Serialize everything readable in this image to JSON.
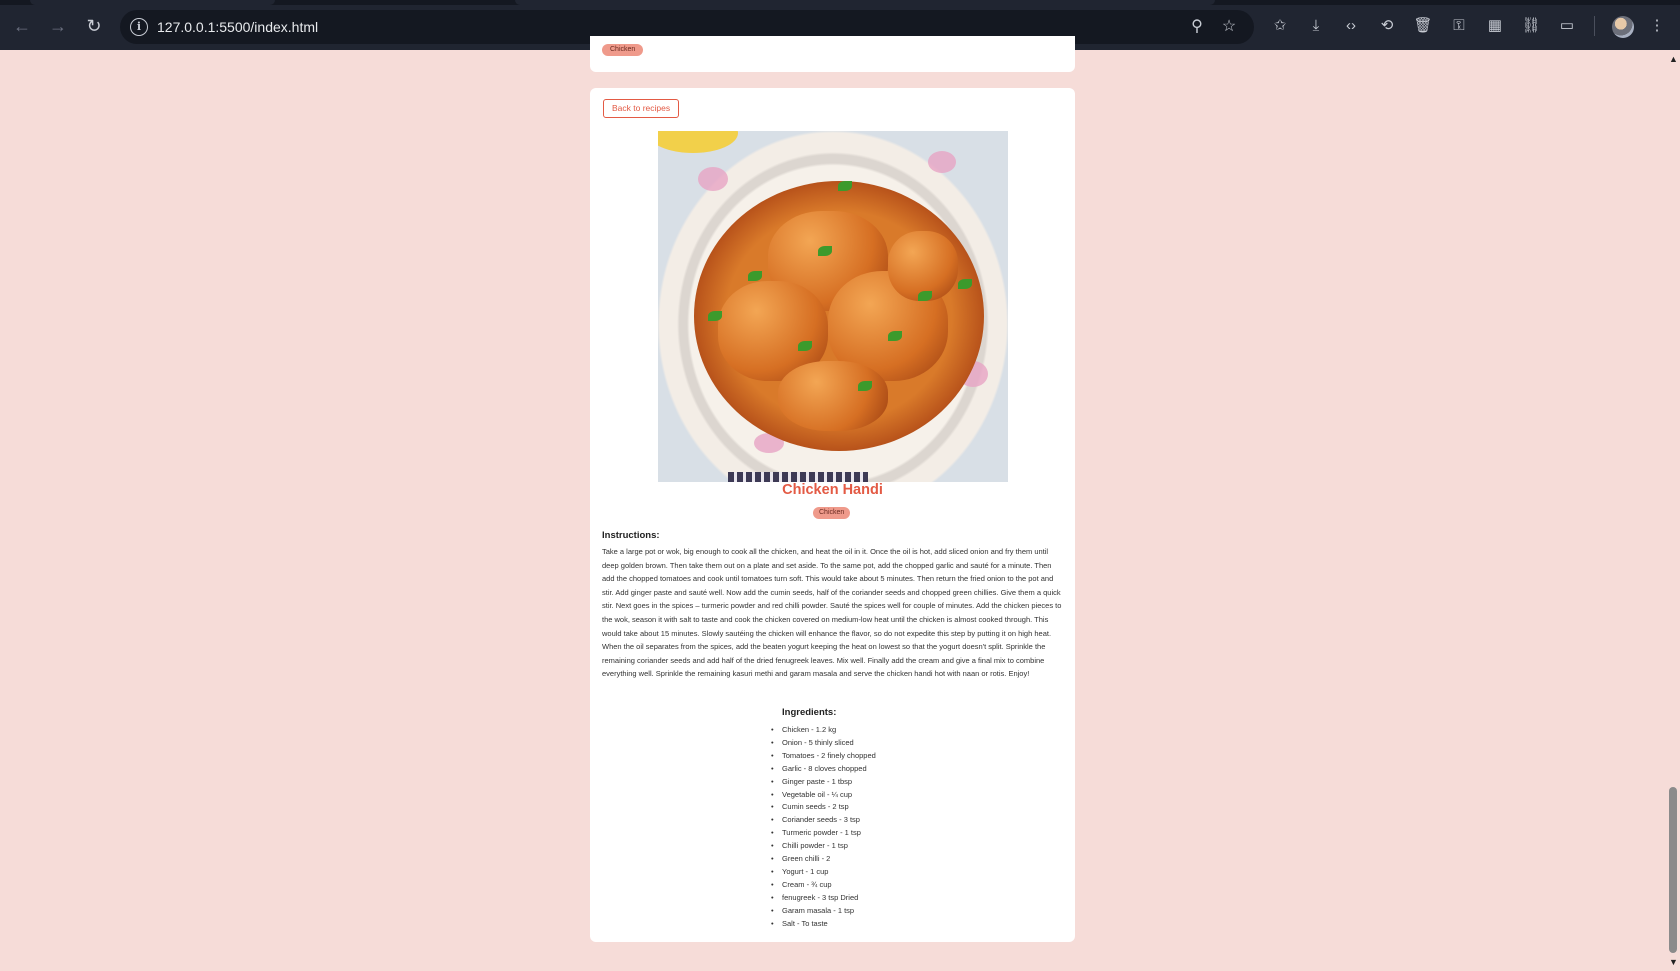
{
  "browser": {
    "url": "127.0.0.1:5500/index.html"
  },
  "previous_card": {
    "tag": "Chicken"
  },
  "recipe": {
    "back_label": "Back to recipes",
    "title": "Chicken Handi",
    "tag": "Chicken",
    "instructions_heading": "Instructions:",
    "instructions": "Take a large pot or wok, big enough to cook all the chicken, and heat the oil in it. Once the oil is hot, add sliced onion and fry them until deep golden brown. Then take them out on a plate and set aside. To the same pot, add the chopped garlic and sauté for a minute. Then add the chopped tomatoes and cook until tomatoes turn soft. This would take about 5 minutes. Then return the fried onion to the pot and stir. Add ginger paste and sauté well. Now add the cumin seeds, half of the coriander seeds and chopped green chillies. Give them a quick stir. Next goes in the spices – turmeric powder and red chilli powder. Sauté the spices well for couple of minutes. Add the chicken pieces to the wok, season it with salt to taste and cook the chicken covered on medium-low heat until the chicken is almost cooked through. This would take about 15 minutes. Slowly sautéing the chicken will enhance the flavor, so do not expedite this step by putting it on high heat. When the oil separates from the spices, add the beaten yogurt keeping the heat on lowest so that the yogurt doesn't split. Sprinkle the remaining coriander seeds and add half of the dried fenugreek leaves. Mix well. Finally add the cream and give a final mix to combine everything well. Sprinkle the remaining kasuri methi and garam masala and serve the chicken handi hot with naan or rotis. Enjoy!",
    "ingredients_heading": "Ingredients:",
    "ingredients": [
      "Chicken - 1.2 kg",
      "Onion - 5 thinly sliced",
      "Tomatoes - 2 finely chopped",
      "Garlic - 8 cloves chopped",
      "Ginger paste - 1 tbsp",
      "Vegetable oil - ¼ cup",
      "Cumin seeds - 2 tsp",
      "Coriander seeds - 3 tsp",
      "Turmeric powder - 1 tsp",
      "Chilli powder - 1 tsp",
      "Green chilli - 2",
      "Yogurt - 1 cup",
      "Cream - ¾ cup",
      "fenugreek - 3 tsp Dried",
      "Garam masala - 1 tsp",
      "Salt - To taste"
    ]
  },
  "colors": {
    "page_bg": "#f6dcd8",
    "accent": "#e35a44",
    "badge_bg": "#ef9a8b",
    "chrome_bg": "#202531"
  }
}
